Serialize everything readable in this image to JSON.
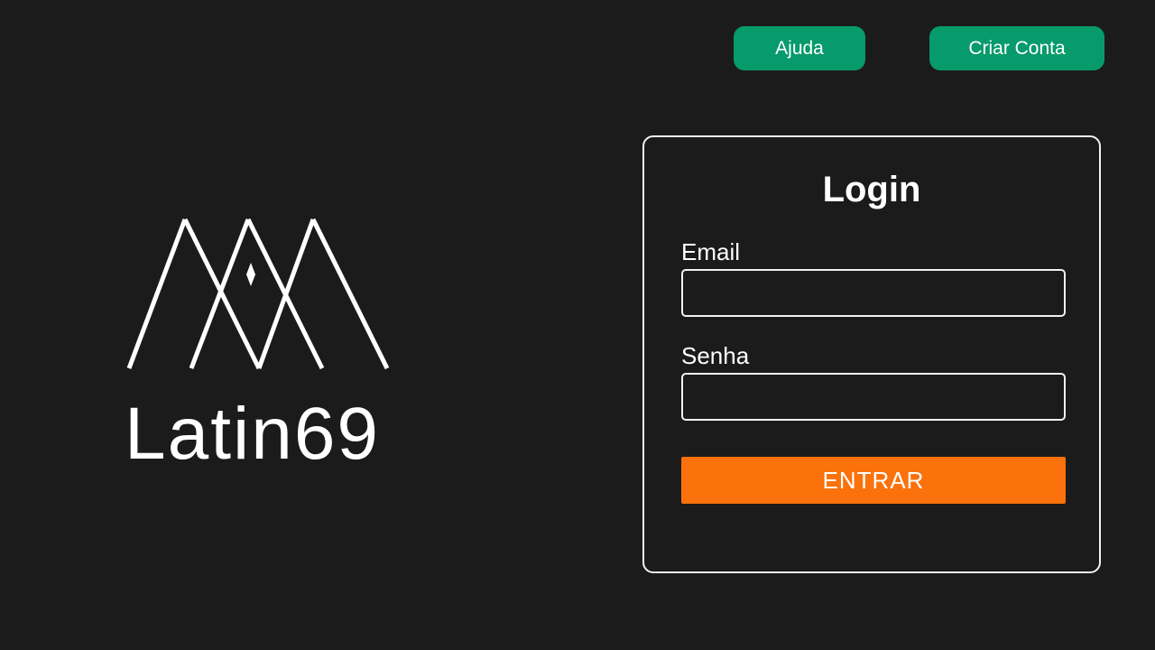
{
  "header": {
    "help_label": "Ajuda",
    "create_account_label": "Criar Conta",
    "button_color": "#079a6b"
  },
  "brand": {
    "logo_text": "Latin69",
    "logo_icon": "mountain-lines-icon"
  },
  "login": {
    "title": "Login",
    "email_label": "Email",
    "email_value": "",
    "email_placeholder": "",
    "password_label": "Senha",
    "password_value": "",
    "password_placeholder": "",
    "submit_label": "ENTRAR",
    "submit_color": "#fb710b"
  },
  "theme": {
    "background": "#1b1b1b",
    "text": "#ffffff"
  }
}
